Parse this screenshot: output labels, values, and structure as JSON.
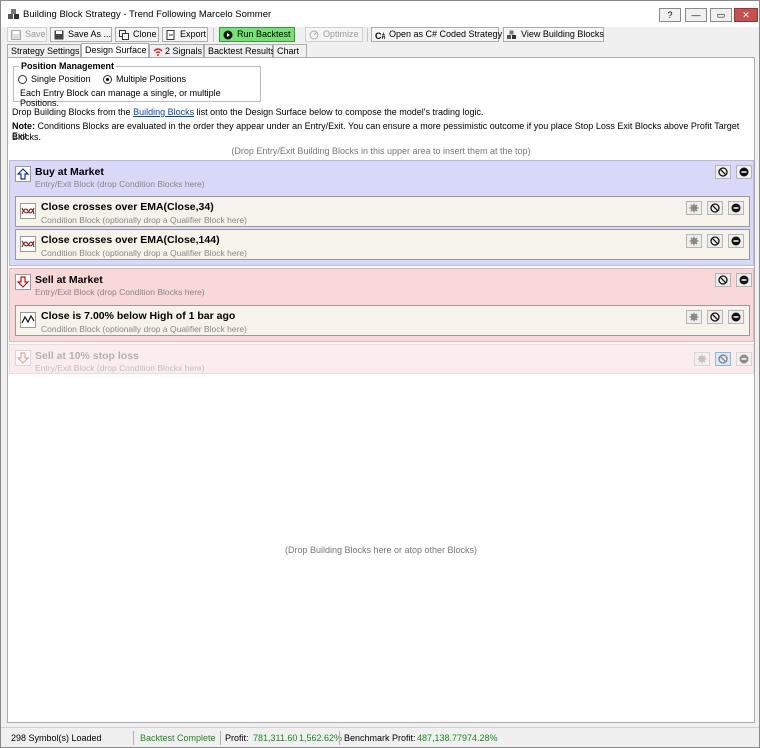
{
  "window": {
    "title": "Building Block Strategy - Trend Following Marcelo Sommer",
    "help": "?",
    "minimize": "—",
    "maximize": "▭",
    "close": "✕"
  },
  "toolbar": {
    "save": "Save",
    "save_as": "Save As ...",
    "clone": "Clone",
    "export": "Export",
    "run_backtest": "Run Backtest",
    "optimize": "Optimize",
    "open_csharp": "Open as C# Coded Strategy",
    "view_blocks": "View Building Blocks"
  },
  "tabs": [
    "Strategy Settings",
    "Design Surface",
    "2 Signals",
    "Backtest Results",
    "Chart"
  ],
  "position_management": {
    "legend": "Position Management",
    "single": "Single Position",
    "multiple": "Multiple Positions",
    "note": "Each Entry Block can manage a single, or multiple Positions.",
    "selected": "multiple"
  },
  "instructions": {
    "drop_pre": "Drop Building Blocks from the ",
    "drop_link": "Building Blocks",
    "drop_post": " list onto the Design Surface below to compose the model's trading logic.",
    "note_label": "Note:",
    "note_line1": " Conditions Blocks are evaluated in the order they appear under an Entry/Exit. You can ensure a more pessimistic outcome if you place Stop Loss Exit Blocks above Profit Target Exit",
    "note_line2": "Blocks."
  },
  "hints": {
    "top": "(Drop Entry/Exit Building Blocks in this upper area to insert them at the top)",
    "bottom": "(Drop Building Blocks here or atop other Blocks)"
  },
  "blocks": {
    "buy": {
      "title": "Buy at Market",
      "subtitle": "Entry/Exit Block (drop Condition Blocks here)"
    },
    "cond1": {
      "title": "Close crosses over EMA(Close,34)",
      "subtitle": "Condition Block (optionally drop a Qualifier Block here)"
    },
    "cond2": {
      "title": "Close crosses over EMA(Close,144)",
      "subtitle": "Condition Block (optionally drop a Qualifier Block here)"
    },
    "sell": {
      "title": "Sell at Market",
      "subtitle": "Entry/Exit Block (drop Condition Blocks here)"
    },
    "cond3": {
      "title": "Close is 7.00% below High of 1 bar ago",
      "subtitle": "Condition Block (optionally drop a Qualifier Block here)"
    },
    "stop": {
      "title": "Sell at 10% stop loss",
      "subtitle": "Entry/Exit Block (drop Condition Blocks here)"
    }
  },
  "status": {
    "symbols": "298 Symbol(s) Loaded",
    "backtest": "Backtest Complete",
    "profit_label": "Profit:",
    "profit_value": "781,311.60",
    "profit_pct": "1,562.62%",
    "benchmark_label": "Benchmark Profit:",
    "benchmark_value": "487,138.77",
    "benchmark_pct": "974.28%"
  },
  "colors": {
    "buy_block": "#d8d8f8",
    "sell_block": "#f8d8d8",
    "condition_block": "#f6f3ea",
    "run_button": "#77e077",
    "status_green": "#1a8a1a"
  }
}
